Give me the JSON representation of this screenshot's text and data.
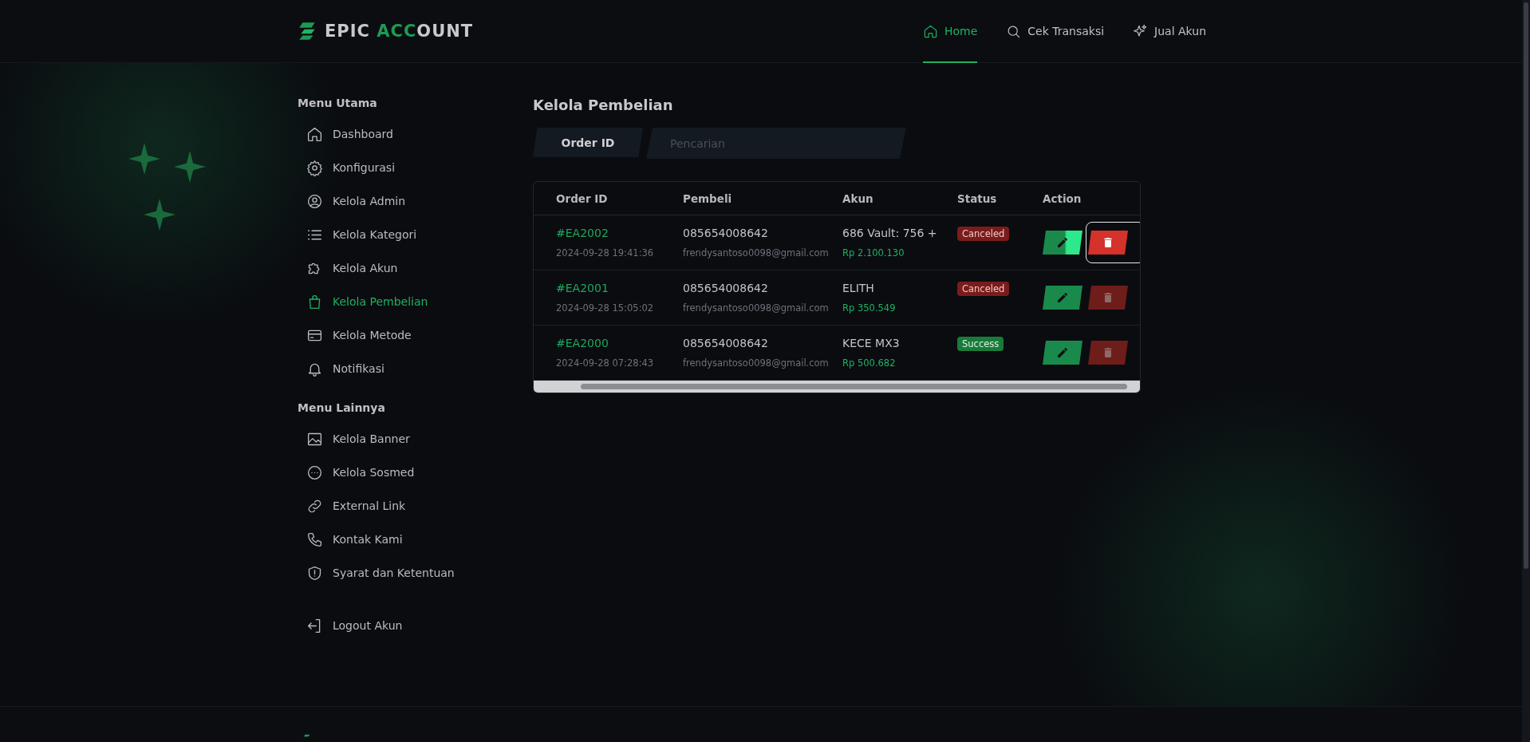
{
  "brand": {
    "part_1": "EPIC",
    "part_2": "ACC",
    "part_3": "OUNT"
  },
  "nav": [
    {
      "label": "Home",
      "selected": true
    },
    {
      "label": "Cek Transaksi",
      "selected": false
    },
    {
      "label": "Jual Akun",
      "selected": false
    }
  ],
  "sidebar": {
    "sections": [
      {
        "title": "Menu Utama",
        "items": [
          {
            "label": "Dashboard",
            "selected": false
          },
          {
            "label": "Konfigurasi",
            "selected": false
          },
          {
            "label": "Kelola Admin",
            "selected": false
          },
          {
            "label": "Kelola Kategori",
            "selected": false
          },
          {
            "label": "Kelola Akun",
            "selected": false
          },
          {
            "label": "Kelola Pembelian",
            "selected": true
          },
          {
            "label": "Kelola Metode",
            "selected": false
          },
          {
            "label": "Notifikasi",
            "selected": false
          }
        ]
      },
      {
        "title": "Menu Lainnya",
        "items": [
          {
            "label": "Kelola Banner",
            "selected": false
          },
          {
            "label": "Kelola Sosmed",
            "selected": false
          },
          {
            "label": "External Link",
            "selected": false
          },
          {
            "label": "Kontak Kami",
            "selected": false
          },
          {
            "label": "Syarat dan Ketentuan",
            "selected": false
          }
        ]
      }
    ],
    "logout": {
      "label": "Logout Akun"
    }
  },
  "page": {
    "title": "Kelola Pembelian"
  },
  "search": {
    "filter": "Order ID",
    "placeholder": "Pencarian"
  },
  "table": {
    "columns": [
      "Order ID",
      "Pembeli",
      "Akun",
      "Status",
      "Action"
    ],
    "rows": [
      {
        "order_id": "#EA2002",
        "date": "2024-09-28 19:41:36",
        "phone": "085654008642",
        "email": "frendysantoso0098@gmail.com",
        "account": "686 Vault: 756 +",
        "price": "Rp 2.100.130",
        "status": "Canceled",
        "kind": "canceled",
        "edit_hovered": true,
        "delete_focused": true
      },
      {
        "order_id": "#EA2001",
        "date": "2024-09-28 15:05:02",
        "phone": "085654008642",
        "email": "frendysantoso0098@gmail.com",
        "account": "ELITH",
        "price": "Rp 350.549",
        "status": "Canceled",
        "kind": "canceled",
        "edit_hovered": false,
        "delete_focused": false
      },
      {
        "order_id": "#EA2000",
        "date": "2024-09-28 07:28:43",
        "phone": "085654008642",
        "email": "frendysantoso0098@gmail.com",
        "account": "KECE MX3",
        "price": "Rp 500.682",
        "status": "Success",
        "kind": "success",
        "edit_hovered": false,
        "delete_focused": false
      }
    ]
  }
}
